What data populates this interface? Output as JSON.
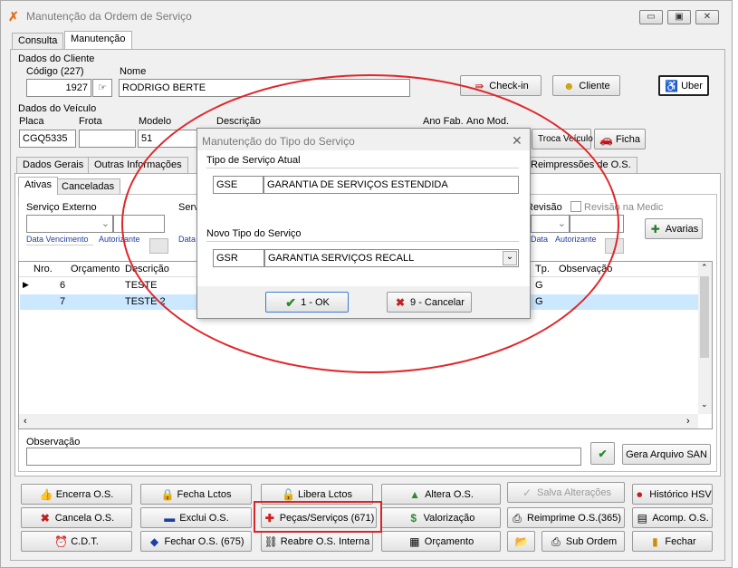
{
  "window": {
    "title": "Manutenção da Ordem de Serviço",
    "min": "▭",
    "max": "▣",
    "close": "✕"
  },
  "tabs": [
    "Consulta",
    "Manutenção"
  ],
  "cliente": {
    "group_label": "Dados do Cliente",
    "codigo_label": "Código (227)",
    "codigo_value": "1927",
    "nome_label": "Nome",
    "nome_value": "RODRIGO BERTE",
    "checkin_label": "Check-in",
    "cliente_label": "Cliente",
    "uber_label": "Uber"
  },
  "veiculo": {
    "group_label": "Dados do Veículo",
    "placa_label": "Placa",
    "placa_value": "CGQ5335",
    "frota_label": "Frota",
    "modelo_label": "Modelo",
    "modelo_value": "51",
    "descricao_label": "Descrição",
    "anofab_label": "Ano Fab.",
    "anomod_label": "Ano Mod.",
    "troca_label": "Troca Veículo",
    "ficha_label": "Ficha"
  },
  "subtabs": [
    "Dados Gerais",
    "Outras Informações",
    "Reimpressões de O.S."
  ],
  "inner_tabs": [
    "Ativas",
    "Canceladas"
  ],
  "servico": {
    "externo_label": "Serviço Externo",
    "serv_label": "Servi",
    "revisao_label": "Revisão",
    "revisao_medic_label": "Revisão na Medic",
    "data_venc": "Data Vencimento",
    "autorizante": "Autorizante",
    "data_short": "Data",
    "avarias_label": "Avarias"
  },
  "grid": {
    "headers": [
      "Nro.",
      "Orçamento",
      "Descrição",
      "Tp.",
      "Observação"
    ],
    "rows": [
      {
        "nro": "6",
        "desc": "TESTE",
        "tp": "G"
      },
      {
        "nro": "7",
        "desc": "TESTE 2",
        "tp": "G"
      }
    ]
  },
  "observacao_label": "Observação",
  "gera_arquivo_label": "Gera Arquivo SAN",
  "dialog": {
    "title": "Manutenção do Tipo do Serviço",
    "atual_label": "Tipo de Serviço Atual",
    "atual_code": "GSE",
    "atual_desc": "GARANTIA DE SERVIÇOS ESTENDIDA",
    "novo_label": "Novo Tipo do Serviço",
    "novo_code": "GSR",
    "novo_desc": "GARANTIA SERVIÇOS RECALL",
    "ok_label": "1 - OK",
    "cancel_label": "9 - Cancelar"
  },
  "actions": {
    "row1": [
      "Encerra O.S.",
      "Fecha Lctos",
      "Libera Lctos",
      "Altera O.S.",
      "Salva Alterações",
      "Histórico HSV"
    ],
    "row2": [
      "Cancela O.S.",
      "Exclui O.S.",
      "Peças/Serviços (671)",
      "Valorização",
      "Reimprime O.S.(365)",
      "Acomp. O.S."
    ],
    "row3": [
      "C.D.T.",
      "Fechar O.S. (675)",
      "Reabre O.S. Interna",
      "Orçamento",
      "Sub Ordem",
      "Fechar"
    ]
  },
  "colors": {
    "highlight": "#e0262a",
    "row_selected": "#cce8ff"
  }
}
